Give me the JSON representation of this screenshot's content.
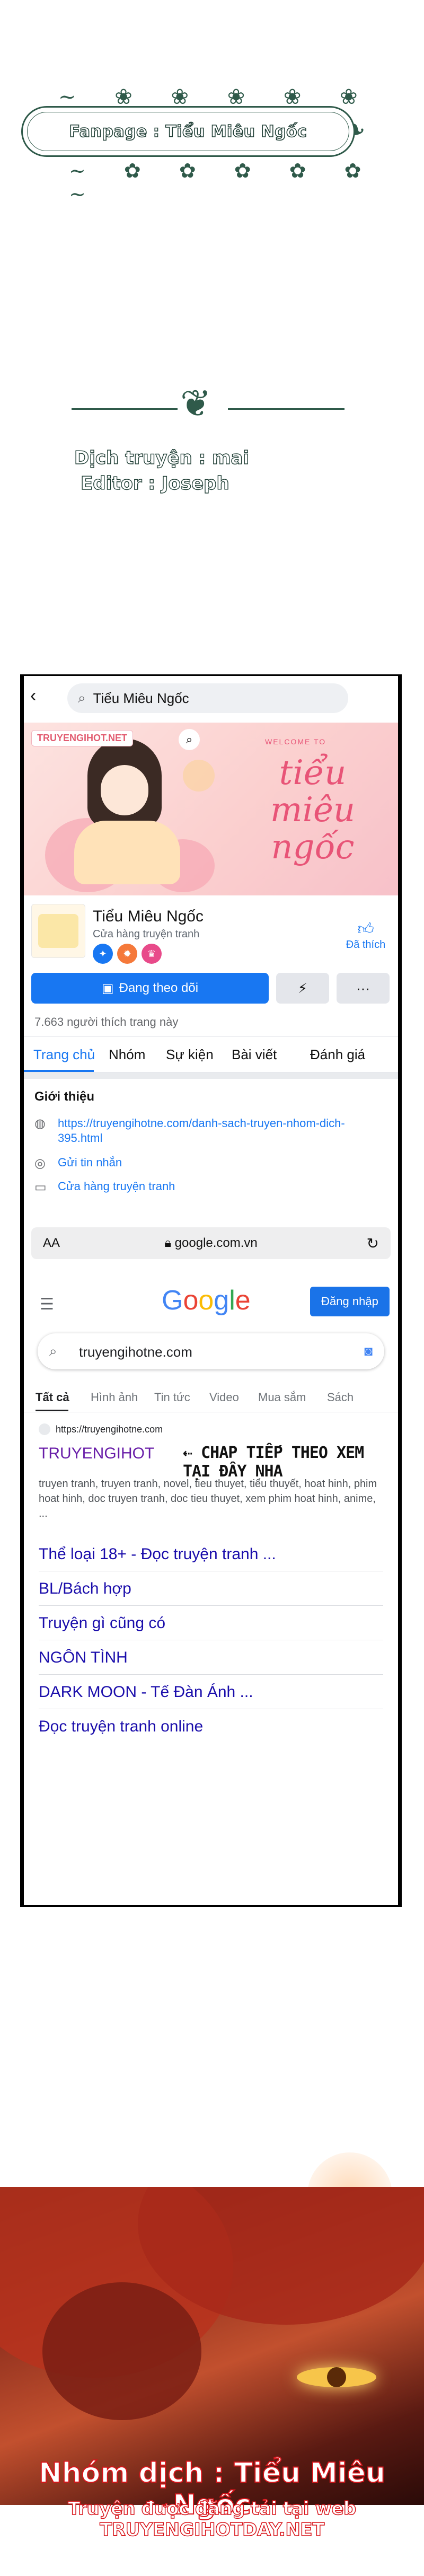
{
  "header": {
    "fanpage_label": "Fanpage : Tiểu Miêu Ngốc"
  },
  "credits": {
    "translator": "Dịch truyện : mai",
    "editor": "Editor : Joseph"
  },
  "facebook": {
    "search_value": "Tiểu Miêu Ngốc",
    "cover": {
      "tag": "TRUYENGIHOT.NET",
      "welcome": "WELCOME TO",
      "title": "tiểu miêu ngốc"
    },
    "page_name": "Tiểu Miêu Ngốc",
    "page_category": "Cửa hàng truyện tranh",
    "liked_label": "Đã thích",
    "follow_label": "Đang theo dõi",
    "likes_count": "7.663 người thích trang này",
    "tabs": [
      "Trang chủ",
      "Nhóm",
      "Sự kiện",
      "Bài viết",
      "Đánh giá"
    ],
    "intro_heading": "Giới thiệu",
    "intro_rows": [
      {
        "icon": "globe-icon",
        "text": "https://truyengihotne.com/danh-sach-truyen-nhom-dich-395.html"
      },
      {
        "icon": "messenger-icon",
        "text": "Gửi tin nhắn"
      },
      {
        "icon": "shop-icon",
        "text": "Cửa hàng truyện tranh"
      }
    ]
  },
  "browser": {
    "aa": "AA",
    "host": "google.com.vn"
  },
  "google": {
    "logo": "Google",
    "signin_label": "Đăng nhập",
    "query": "truyengihotne.com",
    "tabs": [
      "Tất cả",
      "Hình ảnh",
      "Tin tức",
      "Video",
      "Mua sắm",
      "Sách"
    ],
    "result": {
      "url": "https://truyengihotne.com",
      "title": "TRUYENGIHOT",
      "cta": "⇠ CHAP TIẾP THEO XEM TẠI ĐÂY NHA",
      "snippet": "truyen tranh, truyen tranh, novel, tieu thuyet, tiểu thuyết, hoat hinh, phim hoat hinh, doc truyen tranh, doc tieu thuyet, xem phim hoat hinh, anime, ...",
      "sitelinks": [
        "Thể loại 18+ - Đọc truyện tranh ...",
        "BL/Bách hợp",
        "Truyện gì cũng có",
        "NGÔN TÌNH",
        "DARK MOON - Tế Đàn Ánh ...",
        "Đọc truyện tranh online"
      ]
    }
  },
  "footer": {
    "group": "Nhóm dịch : Tiểu Miêu Ngốc",
    "site": "Truyện được đăng tải tại web TRUYENGIHOTDAY.NET"
  },
  "colors": {
    "facebook_blue": "#1877f2",
    "google_blue": "#1a73e8",
    "visited_link": "#681da8",
    "link": "#1a0dab",
    "ornament_green": "#2f5a4a",
    "footer_red": "#d8141a"
  }
}
